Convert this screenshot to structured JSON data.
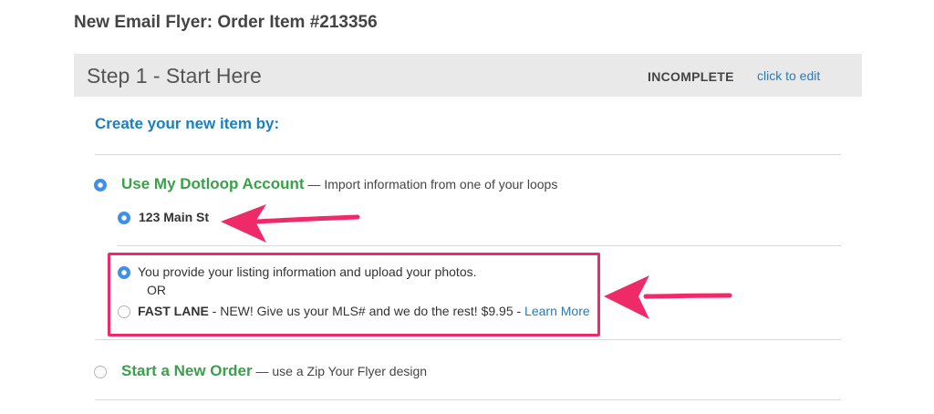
{
  "page": {
    "title": "New Email Flyer: Order Item #213356"
  },
  "step": {
    "title": "Step 1 - Start Here",
    "status": "INCOMPLETE",
    "edit_link": "click to edit"
  },
  "section": {
    "heading": "Create your new item by:"
  },
  "options": {
    "dotloop": {
      "title": "Use My Dotloop Account",
      "desc": " — Import information from one of your loops",
      "selected": true,
      "loop": {
        "label": "123 Main St",
        "selected": true
      }
    },
    "provide": {
      "label": "You provide your listing information and upload your photos.",
      "selected": true
    },
    "or_text": "OR",
    "fast_lane": {
      "name": "FAST LANE",
      "desc": " - NEW! Give us your MLS# and we do the rest! $9.95 - ",
      "link": "Learn More",
      "selected": false
    },
    "new_order": {
      "title": "Start a New Order",
      "desc": " — use a Zip Your Flyer design",
      "selected": false
    }
  },
  "colors": {
    "accent_blue": "#1b7fbd",
    "option_green": "#3aa04a",
    "highlight_pink": "#ee2a69",
    "radio_blue": "#3f8fe6"
  }
}
